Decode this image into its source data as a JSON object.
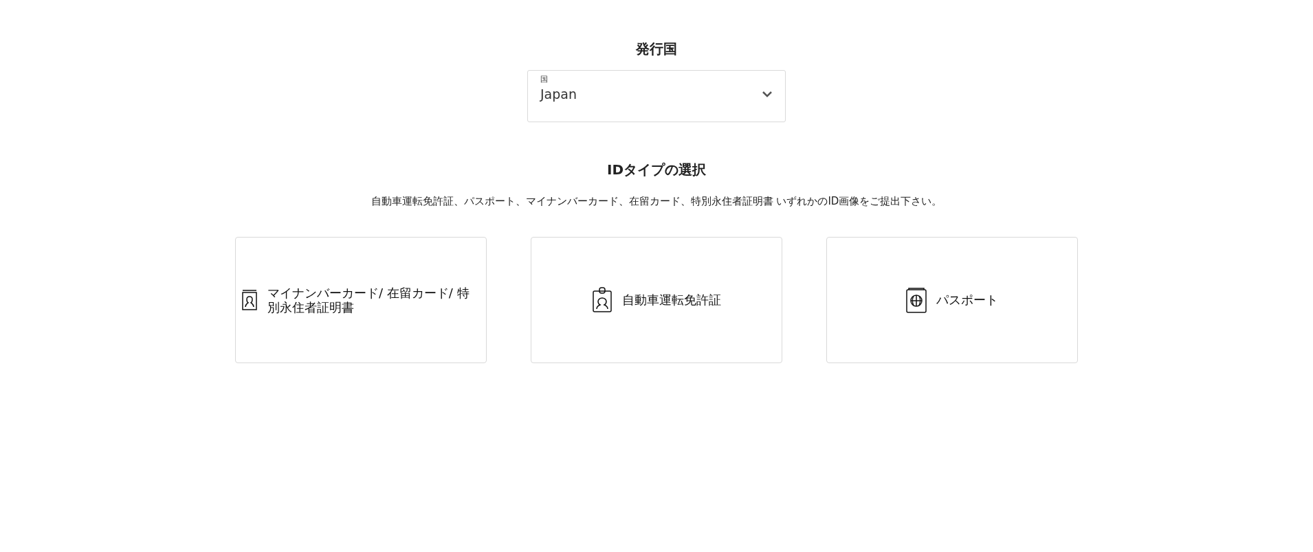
{
  "issuing_country": {
    "title": "発行国",
    "select": {
      "label": "国",
      "value": "Japan"
    }
  },
  "id_type": {
    "title": "IDタイプの選択",
    "description": "自動車運転免許証、パスポート、マイナンバーカード、在留カード、特別永住者証明書 いずれかのID画像をご提出下さい。",
    "options": [
      {
        "kind": "card",
        "label": "マイナンバーカード/ 在留カード/ 特別永住者証明書"
      },
      {
        "kind": "license",
        "label": "自動車運転免許証"
      },
      {
        "kind": "passport",
        "label": "パスポート"
      }
    ]
  }
}
